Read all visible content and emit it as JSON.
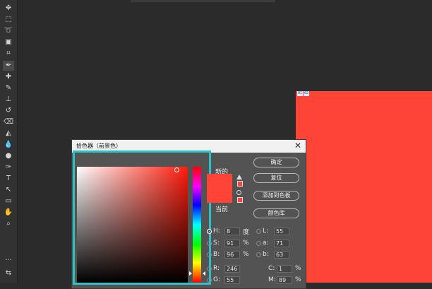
{
  "toolbar": {
    "tools": [
      {
        "name": "move-tool-icon",
        "glyph": "✥"
      },
      {
        "name": "marquee-tool-icon",
        "glyph": "⬚"
      },
      {
        "name": "lasso-tool-icon",
        "glyph": "➰"
      },
      {
        "name": "object-select-tool-icon",
        "glyph": "▣"
      },
      {
        "name": "crop-tool-icon",
        "glyph": "⌗"
      },
      {
        "name": "eyedropper-tool-icon",
        "glyph": "✒"
      },
      {
        "name": "healing-brush-tool-icon",
        "glyph": "✚"
      },
      {
        "name": "brush-tool-icon",
        "glyph": "✎"
      },
      {
        "name": "clone-stamp-tool-icon",
        "glyph": "⊥"
      },
      {
        "name": "history-brush-tool-icon",
        "glyph": "↺"
      },
      {
        "name": "eraser-tool-icon",
        "glyph": "⌫"
      },
      {
        "name": "paint-bucket-tool-icon",
        "glyph": "◭"
      },
      {
        "name": "blur-tool-icon",
        "glyph": "💧"
      },
      {
        "name": "dodge-tool-icon",
        "glyph": "●"
      },
      {
        "name": "pen-tool-icon",
        "glyph": "✑"
      },
      {
        "name": "type-tool-icon",
        "glyph": "T"
      },
      {
        "name": "path-select-tool-icon",
        "glyph": "↖"
      },
      {
        "name": "shape-tool-icon",
        "glyph": "▭"
      },
      {
        "name": "hand-tool-icon",
        "glyph": "✋"
      },
      {
        "name": "zoom-tool-icon",
        "glyph": "⌕"
      },
      {
        "name": "more-tools-icon",
        "glyph": "···"
      },
      {
        "name": "default-colors-icon",
        "glyph": "⇆"
      }
    ]
  },
  "document": {
    "fill_color": "#fd4437",
    "layer_badge": [
      "01",
      "02"
    ]
  },
  "dialog": {
    "title": "拾色器（前景色）",
    "close": "✕",
    "new_label": "新的",
    "current_label": "当前",
    "buttons": {
      "ok": "确定",
      "reset": "复位",
      "add_to_swatches": "添加到色板",
      "color_libraries": "颜色库"
    },
    "hsb": [
      {
        "label": "H:",
        "value": "8",
        "unit": "度"
      },
      {
        "label": "S:",
        "value": "91",
        "unit": "%"
      },
      {
        "label": "B:",
        "value": "96",
        "unit": "%"
      }
    ],
    "lab": [
      {
        "label": "L:",
        "value": "55"
      },
      {
        "label": "a:",
        "value": "71"
      },
      {
        "label": "b:",
        "value": "63"
      }
    ],
    "rgb": [
      {
        "label": "R:",
        "value": "246"
      },
      {
        "label": "G:",
        "value": "55"
      }
    ],
    "cmyk": [
      {
        "label": "C:",
        "value": "1",
        "unit": "%"
      },
      {
        "label": "M:",
        "value": "89",
        "unit": "%"
      }
    ],
    "selected_channel": "H",
    "hue_level": 0.98,
    "accent_color": "#29c2c8"
  }
}
